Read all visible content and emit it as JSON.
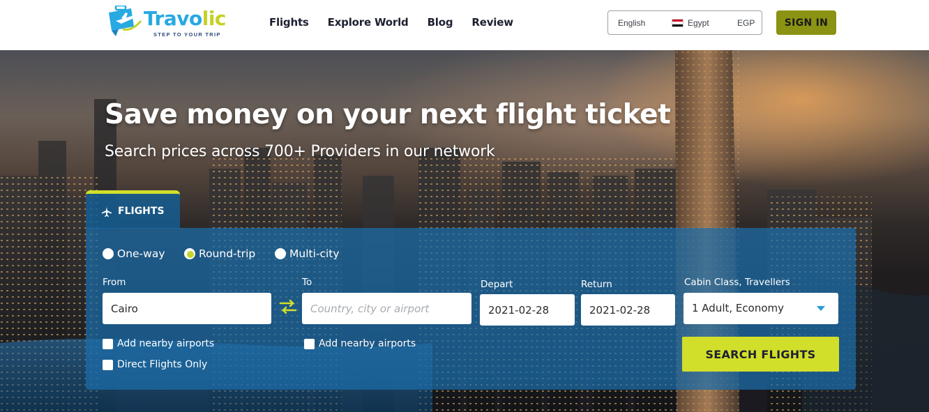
{
  "brand": {
    "name_part1": "Travo",
    "name_part2": "lic",
    "tagline": "STEP TO YOUR TRIP"
  },
  "nav": {
    "items": [
      "Flights",
      "Explore World",
      "Blog",
      "Review"
    ]
  },
  "locale": {
    "language": "English",
    "country": "Egypt",
    "currency": "EGP",
    "flag_icon": "egypt-flag-icon"
  },
  "auth": {
    "signin_label": "SIGN IN"
  },
  "hero": {
    "title": "Save money on your next flight ticket",
    "subtitle": "Search prices across 700+ Providers in our network"
  },
  "search": {
    "tab_label": "FLIGHTS",
    "trip_types": [
      "One-way",
      "Round-trip",
      "Multi-city"
    ],
    "selected_trip_type": "Round-trip",
    "from": {
      "label": "From",
      "value": "Cairo",
      "placeholder": ""
    },
    "to": {
      "label": "To",
      "value": "",
      "placeholder": "Country, city or airport"
    },
    "depart": {
      "label": "Depart",
      "value": "2021-02-28"
    },
    "return": {
      "label": "Return",
      "value": "2021-02-28"
    },
    "cabin": {
      "label": "Cabin Class, Travellers",
      "value": "1 Adult, Economy"
    },
    "from_nearby_label": "Add nearby airports",
    "to_nearby_label": "Add nearby airports",
    "direct_label": "Direct Flights Only",
    "submit_label": "SEARCH FLIGHTS"
  },
  "colors": {
    "brand_blue": "#27a9e1",
    "accent_lime": "#d2df2a",
    "signin_olive": "#8a9313",
    "panel_blue": "#1c6eaa"
  }
}
